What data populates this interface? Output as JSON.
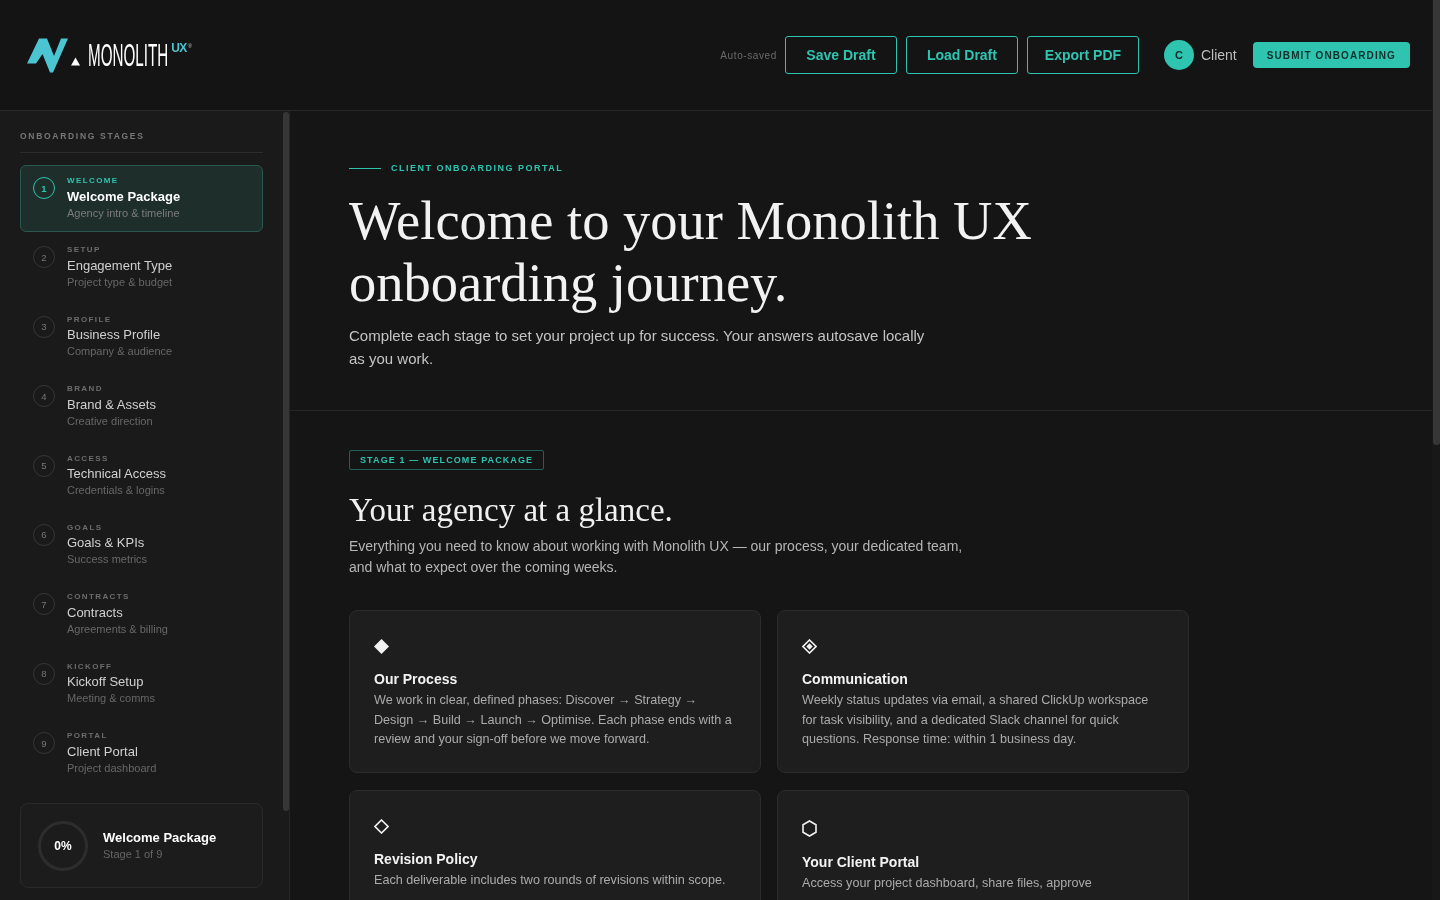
{
  "header": {
    "logo": {
      "name": "MONOLITH",
      "suffix": "UX",
      "mark": "®"
    },
    "save_status": "Auto-saved",
    "buttons": [
      {
        "label": "Save Draft"
      },
      {
        "label": "Load Draft"
      },
      {
        "label": "Export PDF"
      }
    ],
    "user": {
      "initial": "C",
      "name": "Client"
    },
    "submit": {
      "label": "SUBMIT ONBOARDING"
    }
  },
  "sidebar": {
    "heading": "ONBOARDING STAGES",
    "stages": [
      {
        "number": "1",
        "tag": "WELCOME",
        "title": "Welcome Package",
        "subtitle": "Agency intro & timeline",
        "selected": true
      },
      {
        "number": "2",
        "tag": "SETUP",
        "title": "Engagement Type",
        "subtitle": "Project type & budget",
        "selected": false
      },
      {
        "number": "3",
        "tag": "PROFILE",
        "title": "Business Profile",
        "subtitle": "Company & audience",
        "selected": false
      },
      {
        "number": "4",
        "tag": "BRAND",
        "title": "Brand & Assets",
        "subtitle": "Creative direction",
        "selected": false
      },
      {
        "number": "5",
        "tag": "ACCESS",
        "title": "Technical Access",
        "subtitle": "Credentials & logins",
        "selected": false
      },
      {
        "number": "6",
        "tag": "GOALS",
        "title": "Goals & KPIs",
        "subtitle": "Success metrics",
        "selected": false
      },
      {
        "number": "7",
        "tag": "CONTRACTS",
        "title": "Contracts",
        "subtitle": "Agreements & billing",
        "selected": false
      },
      {
        "number": "8",
        "tag": "KICKOFF",
        "title": "Kickoff Setup",
        "subtitle": "Meeting & comms",
        "selected": false
      },
      {
        "number": "9",
        "tag": "PORTAL",
        "title": "Client Portal",
        "subtitle": "Project dashboard",
        "selected": false
      }
    ],
    "progress": {
      "level": 0,
      "percent": "0%",
      "title": "Welcome Package",
      "subtitle": "Stage 1 of 9"
    }
  },
  "hero": {
    "eyebrow": "CLIENT ONBOARDING PORTAL",
    "title": "Welcome to your Monolith UX onboarding journey.",
    "subtitle": "Complete each stage to set your project up for success. Your answers autosave locally as you work."
  },
  "section": {
    "badge": "STAGE 1 — WELCOME PACKAGE",
    "title": "Your agency at a glance.",
    "intro": "Everything you need to know about working with Monolith UX — our process, your dedicated team, and what to expect over the coming weeks.",
    "cards": [
      {
        "title": "Our Process",
        "body": "We work in clear, defined phases: Discover → Strategy → Design → Build → Launch → Optimise. Each phase ends with a review and your sign-off before we move forward."
      },
      {
        "title": "Communication",
        "body": "Weekly status updates via email, a shared ClickUp workspace for task visibility, and a dedicated Slack channel for quick questions. Response time: within 1 business day."
      },
      {
        "title": "Revision Policy",
        "body": "Each deliverable includes two rounds of revisions within scope."
      },
      {
        "title": "Your Client Portal",
        "body": "Access your project dashboard, share files, approve"
      }
    ]
  }
}
